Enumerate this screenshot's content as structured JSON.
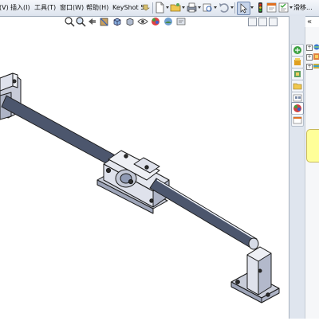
{
  "menus": [
    {
      "id": "menu-view",
      "label": "(V)"
    },
    {
      "id": "menu-insert",
      "label": "插入(I)"
    },
    {
      "id": "menu-tools",
      "label": "工具(T)"
    },
    {
      "id": "menu-window",
      "label": "窗口(W)"
    },
    {
      "id": "menu-help",
      "label": "帮助(H)"
    },
    {
      "id": "menu-keyshot",
      "label": "KeyShot 5"
    }
  ],
  "toolbar": {
    "right_caption": "滑移..."
  },
  "icons": {
    "keyshot_pin": "pin-icon",
    "new": "new-document-icon",
    "open": "open-folder-icon",
    "print": "print-icon",
    "undo": "undo-icon",
    "select": "select-arrow-icon",
    "rebuild": "traffic-light-rebuild-icon",
    "file_props": "file-properties-icon",
    "options": "options-icon"
  },
  "colors": {
    "toolbar_top": "#f5f7fb",
    "toolbar_bottom": "#dde4ee",
    "rod_light": "#dfe5f2",
    "rod_mid": "#8f9ab4",
    "rod_dark": "#4c566d",
    "block_face": "#dfe2ec",
    "block_side": "#aeb4c6",
    "edge": "#1a1a1a",
    "note_yellow": "#ffff99"
  }
}
